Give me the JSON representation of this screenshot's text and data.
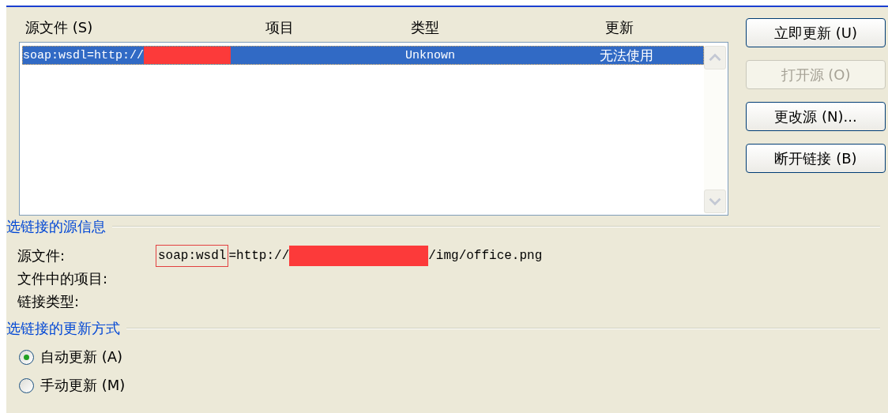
{
  "columns": [
    "源文件 (S)",
    "项目",
    "类型",
    "更新"
  ],
  "rows": [
    {
      "selected": true,
      "cells": [
        "soap:wsdl=http://",
        "",
        "Unknown",
        "无法使用"
      ],
      "redacted": true
    }
  ],
  "buttons": [
    {
      "label": "立即更新 (U)",
      "disabled": false
    },
    {
      "label": "打开源 (O)",
      "disabled": true
    },
    {
      "label": "更改源 (N)...",
      "disabled": false
    },
    {
      "label": "断开链接 (B)",
      "disabled": false
    }
  ],
  "source_info": {
    "heading": "选链接的源信息",
    "fields": [
      {
        "label": "源文件:",
        "value_prefix": "soap:wsdl",
        "value_mid": "=http://",
        "value_suffix": "/img/office.png",
        "redacted": true
      },
      {
        "label": "文件中的项目:"
      },
      {
        "label": "链接类型:"
      }
    ]
  },
  "update_method": {
    "heading": "选链接的更新方式",
    "options": [
      {
        "label": "自动更新 (A)",
        "selected": true
      },
      {
        "label": "手动更新 (M)",
        "selected": false
      }
    ]
  }
}
